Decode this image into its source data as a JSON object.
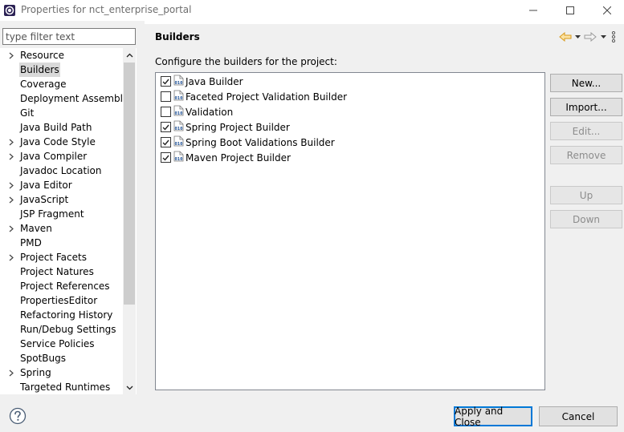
{
  "window": {
    "title": "Properties for nct_enterprise_portal",
    "minimize_icon": "minimize-icon",
    "maximize_icon": "maximize-icon",
    "close_icon": "close-icon"
  },
  "filter": {
    "placeholder": "type filter text",
    "value": ""
  },
  "tree": {
    "items": [
      {
        "label": "Resource",
        "expandable": true,
        "selected": false
      },
      {
        "label": "Builders",
        "expandable": false,
        "selected": true
      },
      {
        "label": "Coverage",
        "expandable": false,
        "selected": false
      },
      {
        "label": "Deployment Assembly",
        "expandable": false,
        "selected": false
      },
      {
        "label": "Git",
        "expandable": false,
        "selected": false
      },
      {
        "label": "Java Build Path",
        "expandable": false,
        "selected": false
      },
      {
        "label": "Java Code Style",
        "expandable": true,
        "selected": false
      },
      {
        "label": "Java Compiler",
        "expandable": true,
        "selected": false
      },
      {
        "label": "Javadoc Location",
        "expandable": false,
        "selected": false
      },
      {
        "label": "Java Editor",
        "expandable": true,
        "selected": false
      },
      {
        "label": "JavaScript",
        "expandable": true,
        "selected": false
      },
      {
        "label": "JSP Fragment",
        "expandable": false,
        "selected": false
      },
      {
        "label": "Maven",
        "expandable": true,
        "selected": false
      },
      {
        "label": "PMD",
        "expandable": false,
        "selected": false
      },
      {
        "label": "Project Facets",
        "expandable": true,
        "selected": false
      },
      {
        "label": "Project Natures",
        "expandable": false,
        "selected": false
      },
      {
        "label": "Project References",
        "expandable": false,
        "selected": false
      },
      {
        "label": "PropertiesEditor",
        "expandable": false,
        "selected": false
      },
      {
        "label": "Refactoring History",
        "expandable": false,
        "selected": false
      },
      {
        "label": "Run/Debug Settings",
        "expandable": false,
        "selected": false
      },
      {
        "label": "Service Policies",
        "expandable": false,
        "selected": false
      },
      {
        "label": "SpotBugs",
        "expandable": false,
        "selected": false
      },
      {
        "label": "Spring",
        "expandable": true,
        "selected": false
      },
      {
        "label": "Targeted Runtimes",
        "expandable": false,
        "selected": false
      }
    ]
  },
  "page": {
    "title": "Builders",
    "description": "Configure the builders for the project:",
    "builders": [
      {
        "label": "Java Builder",
        "checked": true
      },
      {
        "label": "Faceted Project Validation Builder",
        "checked": false
      },
      {
        "label": "Validation",
        "checked": false
      },
      {
        "label": "Spring Project Builder",
        "checked": true
      },
      {
        "label": "Spring Boot Validations Builder",
        "checked": true
      },
      {
        "label": "Maven Project Builder",
        "checked": true
      }
    ],
    "buttons": {
      "new": "New...",
      "import": "Import...",
      "edit": "Edit...",
      "remove": "Remove",
      "up": "Up",
      "down": "Down"
    }
  },
  "footer": {
    "apply_close": "Apply and Close",
    "cancel": "Cancel"
  },
  "colors": {
    "accent": "#0078d7",
    "back_arrow": "#d99a1c",
    "selection": "#d9d9d9"
  }
}
